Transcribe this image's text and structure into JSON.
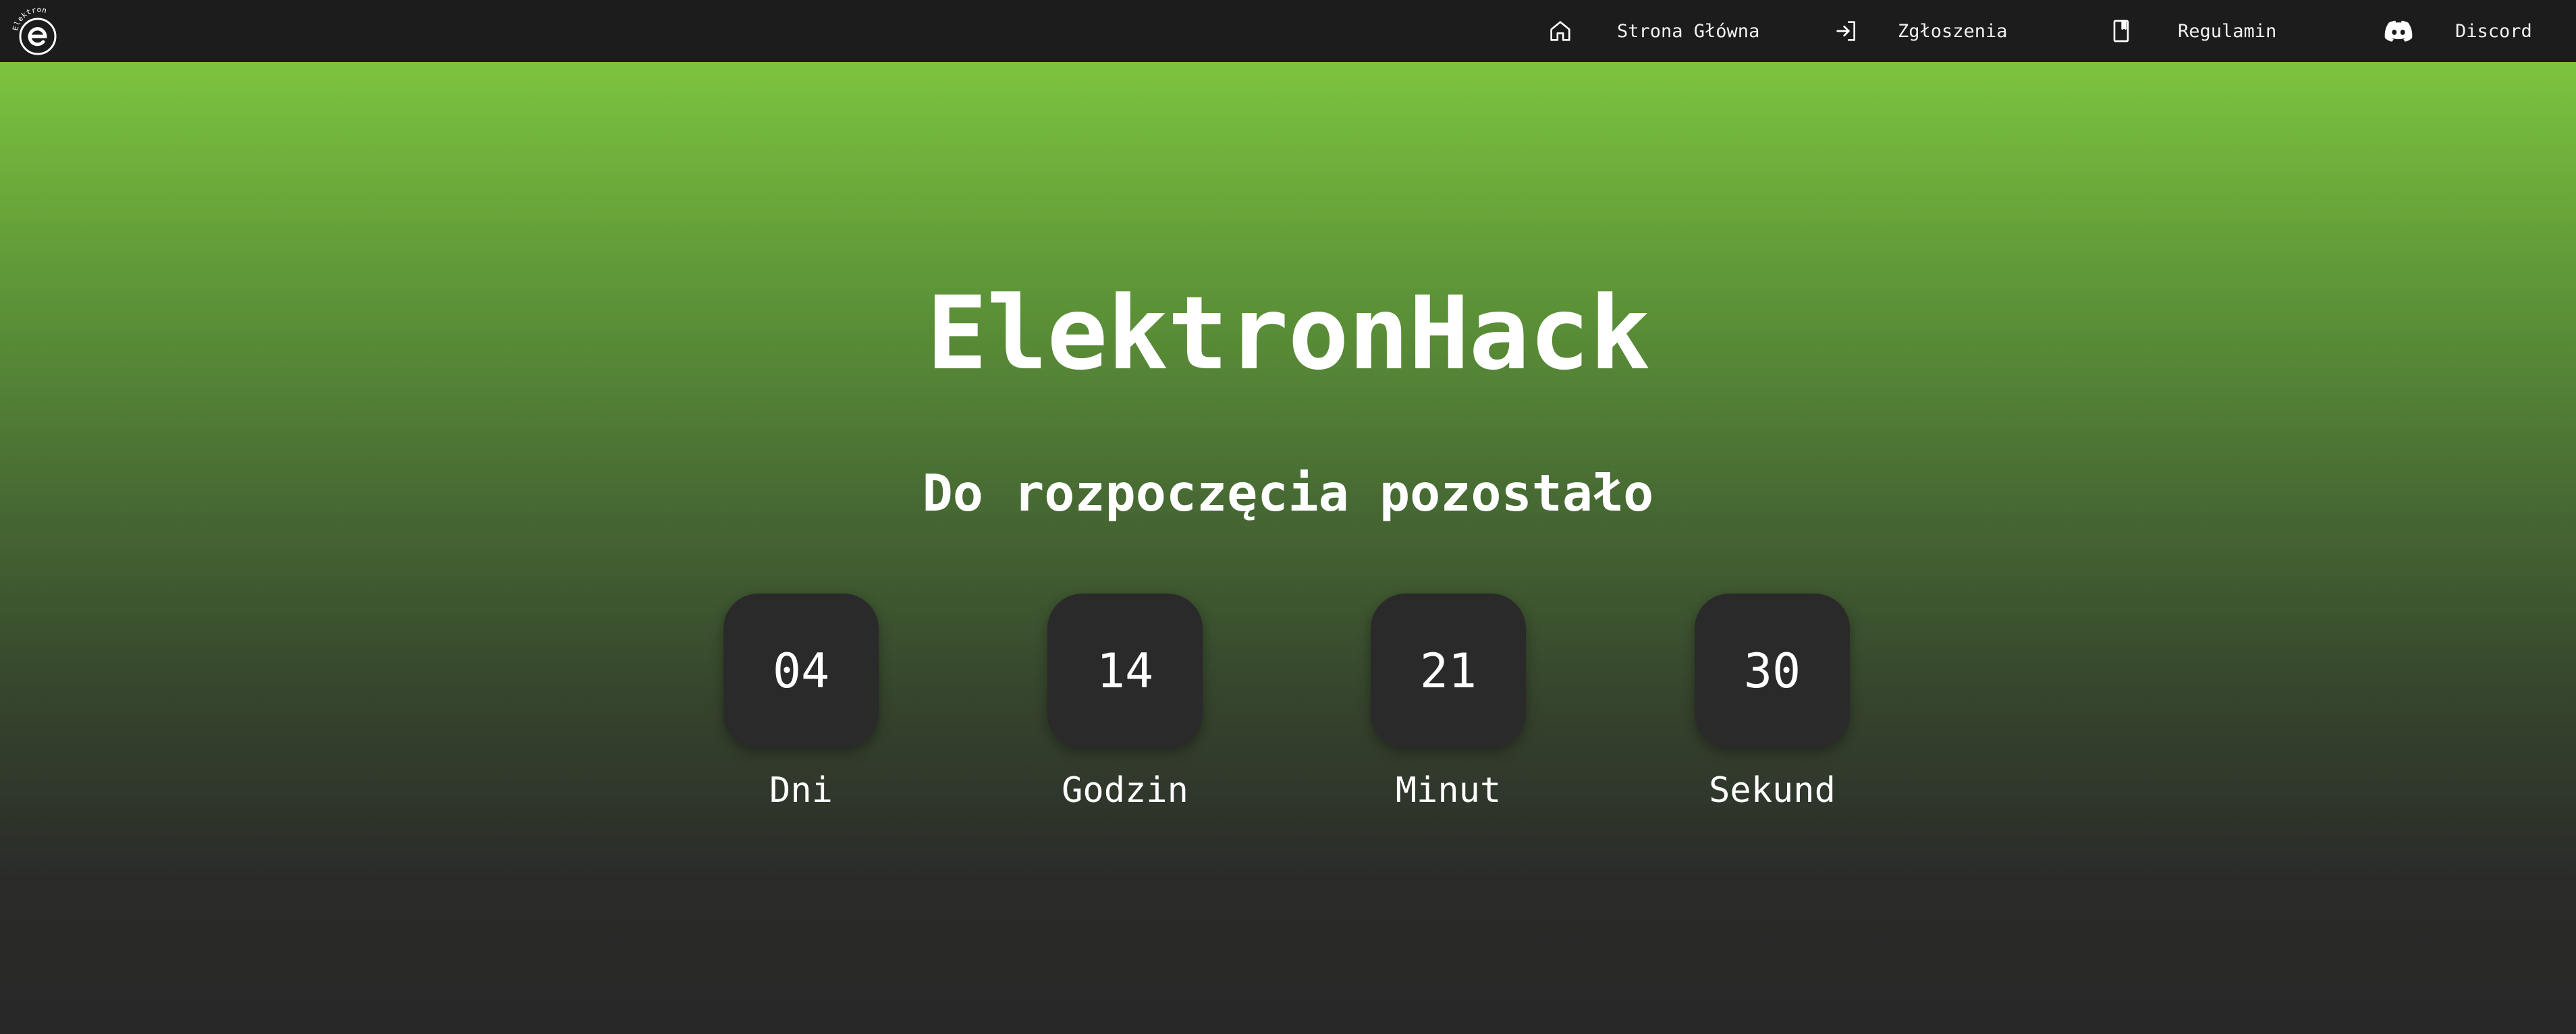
{
  "nav": {
    "logo_text": "Elektron",
    "items": [
      {
        "label": "Strona Główna",
        "icon": "home-icon"
      },
      {
        "label": "Zgłoszenia",
        "icon": "login-icon"
      },
      {
        "label": "Regulamin",
        "icon": "bookmark-icon"
      },
      {
        "label": "Discord",
        "icon": "discord-icon"
      }
    ]
  },
  "hero": {
    "title": "ElektronHack",
    "subtitle": "Do rozpoczęcia pozostało",
    "countdown": [
      {
        "value": "04",
        "label": "Dni"
      },
      {
        "value": "14",
        "label": "Godzin"
      },
      {
        "value": "21",
        "label": "Minut"
      },
      {
        "value": "30",
        "label": "Sekund"
      }
    ]
  },
  "colors": {
    "navbar": "#1c1c1c",
    "gradient_top": "#7dc43f",
    "gradient_bottom": "#282828",
    "countdown_box": "#2a2a2a",
    "text": "#ffffff"
  }
}
